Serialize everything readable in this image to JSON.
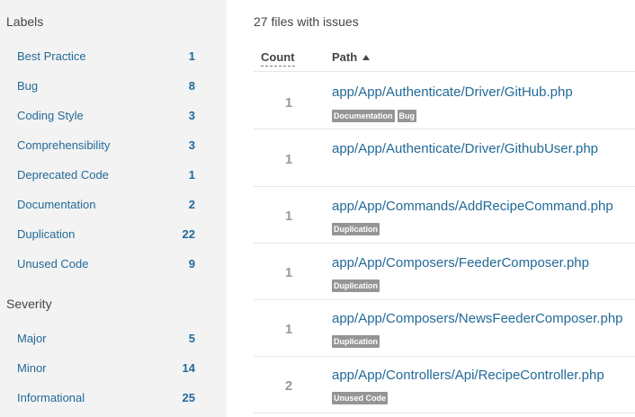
{
  "sidebar": {
    "labels_title": "Labels",
    "labels": [
      {
        "label": "Best Practice",
        "count": "1"
      },
      {
        "label": "Bug",
        "count": "8"
      },
      {
        "label": "Coding Style",
        "count": "3"
      },
      {
        "label": "Comprehensibility",
        "count": "3"
      },
      {
        "label": "Deprecated Code",
        "count": "1"
      },
      {
        "label": "Documentation",
        "count": "2"
      },
      {
        "label": "Duplication",
        "count": "22"
      },
      {
        "label": "Unused Code",
        "count": "9"
      }
    ],
    "severity_title": "Severity",
    "severity": [
      {
        "label": "Major",
        "count": "5"
      },
      {
        "label": "Minor",
        "count": "14"
      },
      {
        "label": "Informational",
        "count": "25"
      }
    ]
  },
  "main": {
    "summary": "27 files with issues",
    "columns": {
      "count": "Count",
      "path": "Path"
    },
    "sort_icon": "caret-up-icon",
    "rows": [
      {
        "count": "1",
        "path": "app/App/Authenticate/Driver/GitHub.php",
        "tags": [
          "Documentation",
          "Bug"
        ]
      },
      {
        "count": "1",
        "path": "app/App/Authenticate/Driver/GithubUser.php",
        "tags": []
      },
      {
        "count": "1",
        "path": "app/App/Commands/AddRecipeCommand.php",
        "tags": [
          "Duplication"
        ]
      },
      {
        "count": "1",
        "path": "app/App/Composers/FeederComposer.php",
        "tags": [
          "Duplication"
        ]
      },
      {
        "count": "1",
        "path": "app/App/Composers/NewsFeederComposer.php",
        "tags": [
          "Duplication"
        ]
      },
      {
        "count": "2",
        "path": "app/App/Controllers/Api/RecipeController.php",
        "tags": [
          "Unused Code"
        ]
      }
    ]
  },
  "colors": {
    "link": "#236a97",
    "sidebar_bg": "#f3f3f3",
    "tag_bg": "#959595"
  }
}
